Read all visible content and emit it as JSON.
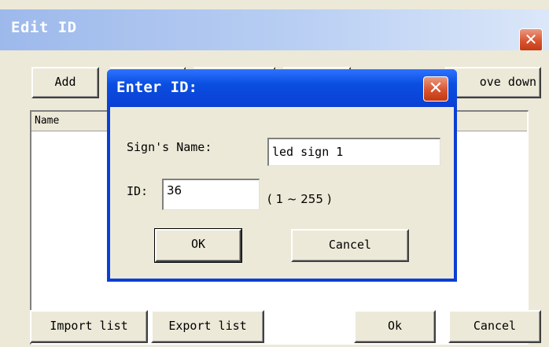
{
  "outer_dialog": {
    "title": "Edit ID",
    "close_glyph": "✕",
    "toolbar": {
      "add_label": "Add",
      "move_down_label": "ove down"
    },
    "list": {
      "columns": [
        "Name"
      ]
    },
    "footer": {
      "import_label": "Import list",
      "export_label": "Export list",
      "ok_label": "Ok",
      "cancel_label": "Cancel"
    }
  },
  "inner_dialog": {
    "title": "Enter ID:",
    "close_glyph": "✕",
    "name_label": "Sign's Name:",
    "name_value": "led sign 1",
    "id_label": "ID:",
    "id_value": "36",
    "range_text": "( 1 ~ 255 )",
    "ok_label": "OK",
    "cancel_label": "Cancel"
  },
  "colors": {
    "outer_title_gradient": [
      "#9db9eb",
      "#dbe7f9"
    ],
    "inner_title": "#0a4ee0",
    "close_button": "#d9532f",
    "dialog_face": "#ece9d8"
  }
}
